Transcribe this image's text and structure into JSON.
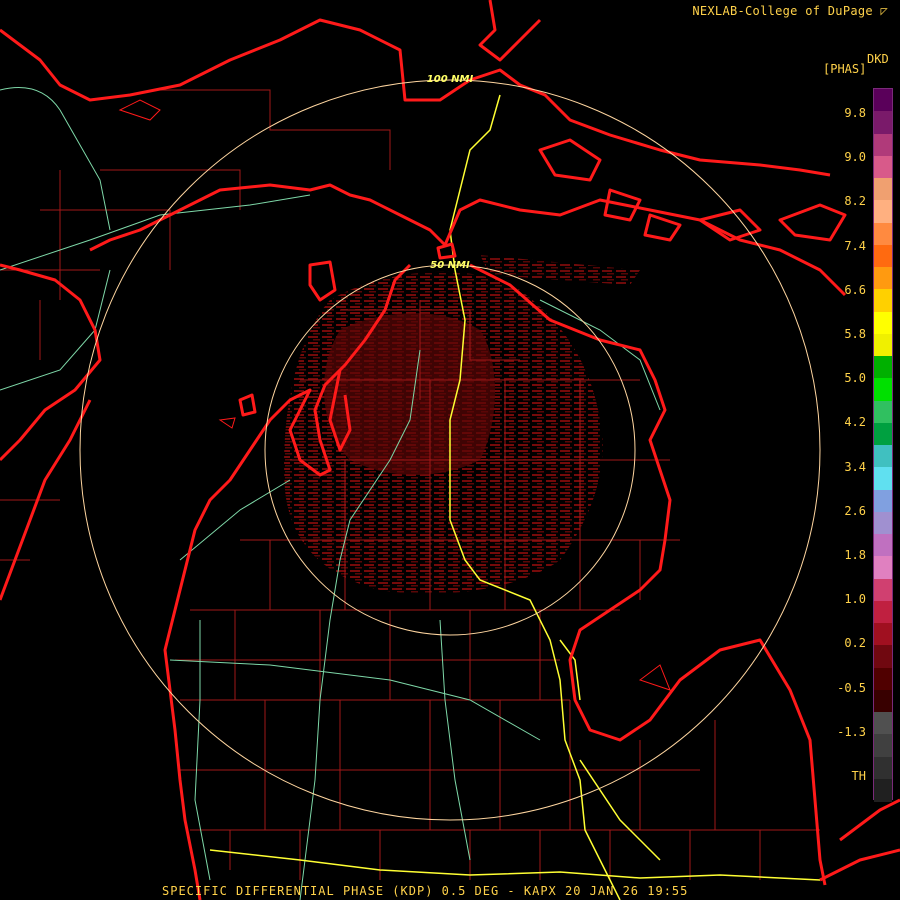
{
  "header": {
    "credit": "NEXLAB-College of DuPage",
    "product_code": "DKD",
    "unit": "[PHAS]"
  },
  "map": {
    "ring_labels": [
      "100 NMI",
      "50 NMI"
    ],
    "colors": {
      "coastline": "#ff1a1a",
      "counties": "#a01818",
      "highways_minor": "#7ed8a8",
      "highways_interstate": "#ffff33",
      "range_ring": "#ffd6a0",
      "echo": "#7a0a0a"
    }
  },
  "legend": {
    "ticks": [
      "9.8",
      "9.0",
      "8.2",
      "7.4",
      "6.6",
      "5.8",
      "5.0",
      "4.2",
      "3.4",
      "2.6",
      "1.8",
      "1.0",
      "0.2",
      "-0.5",
      "-1.3",
      "TH"
    ],
    "colors": [
      "#5a005a",
      "#7a1a6a",
      "#b03a7a",
      "#d85a8a",
      "#f0a070",
      "#ffb080",
      "#ff8a40",
      "#ff6a10",
      "#ff9a10",
      "#ffd000",
      "#ffff00",
      "#f0f000",
      "#00b000",
      "#00e000",
      "#30c060",
      "#00a040",
      "#40c0c0",
      "#60e0f0",
      "#80a0e0",
      "#a090d0",
      "#c070c0",
      "#e080c0",
      "#d04070",
      "#c02040",
      "#a01020",
      "#700810",
      "#500000",
      "#380000",
      "#505050",
      "#404040",
      "#303030",
      "#202020"
    ]
  },
  "footer": {
    "caption": "SPECIFIC DIFFERENTIAL PHASE (KDP) 0.5 DEG - KAPX 20 JAN 26 19:55"
  }
}
